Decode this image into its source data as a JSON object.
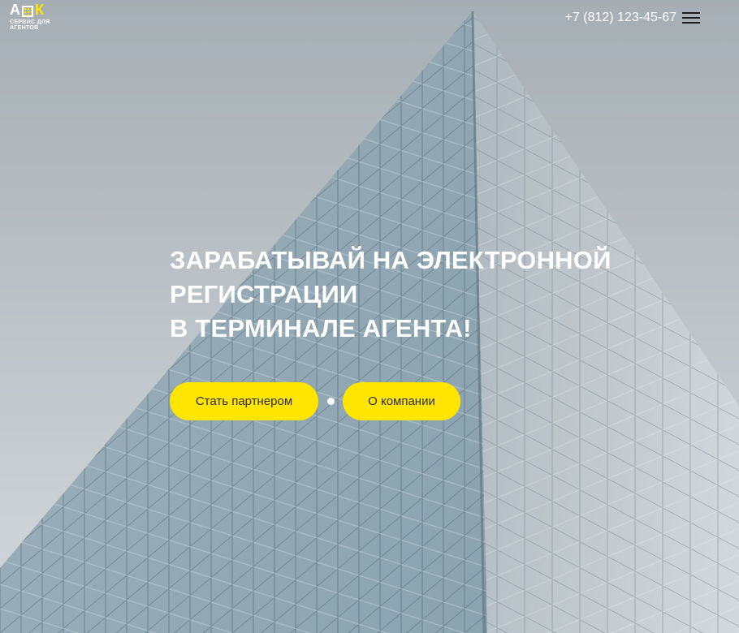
{
  "header": {
    "logo_letters": [
      "А",
      "К"
    ],
    "logo_caption": "СЕРВИС ДЛЯ АГЕНТОВ",
    "phone": "+7 (812) 123-45-67",
    "menu_icon": "hamburger-menu-icon"
  },
  "hero": {
    "headline_lines": [
      "ЗАРАБАТЫВАЙ НА ЭЛЕКТРОННОЙ",
      "РЕГИСТРАЦИИ",
      "В ТЕРМИНАЛЕ АГЕНТА!"
    ],
    "primary_button": "Стать партнером",
    "secondary_button": "О компании"
  },
  "colors": {
    "accent": "#ffe500",
    "text_on_image": "#ffffff",
    "button_text": "#2d2d2d",
    "menu_icon": "#1e1e1e"
  }
}
